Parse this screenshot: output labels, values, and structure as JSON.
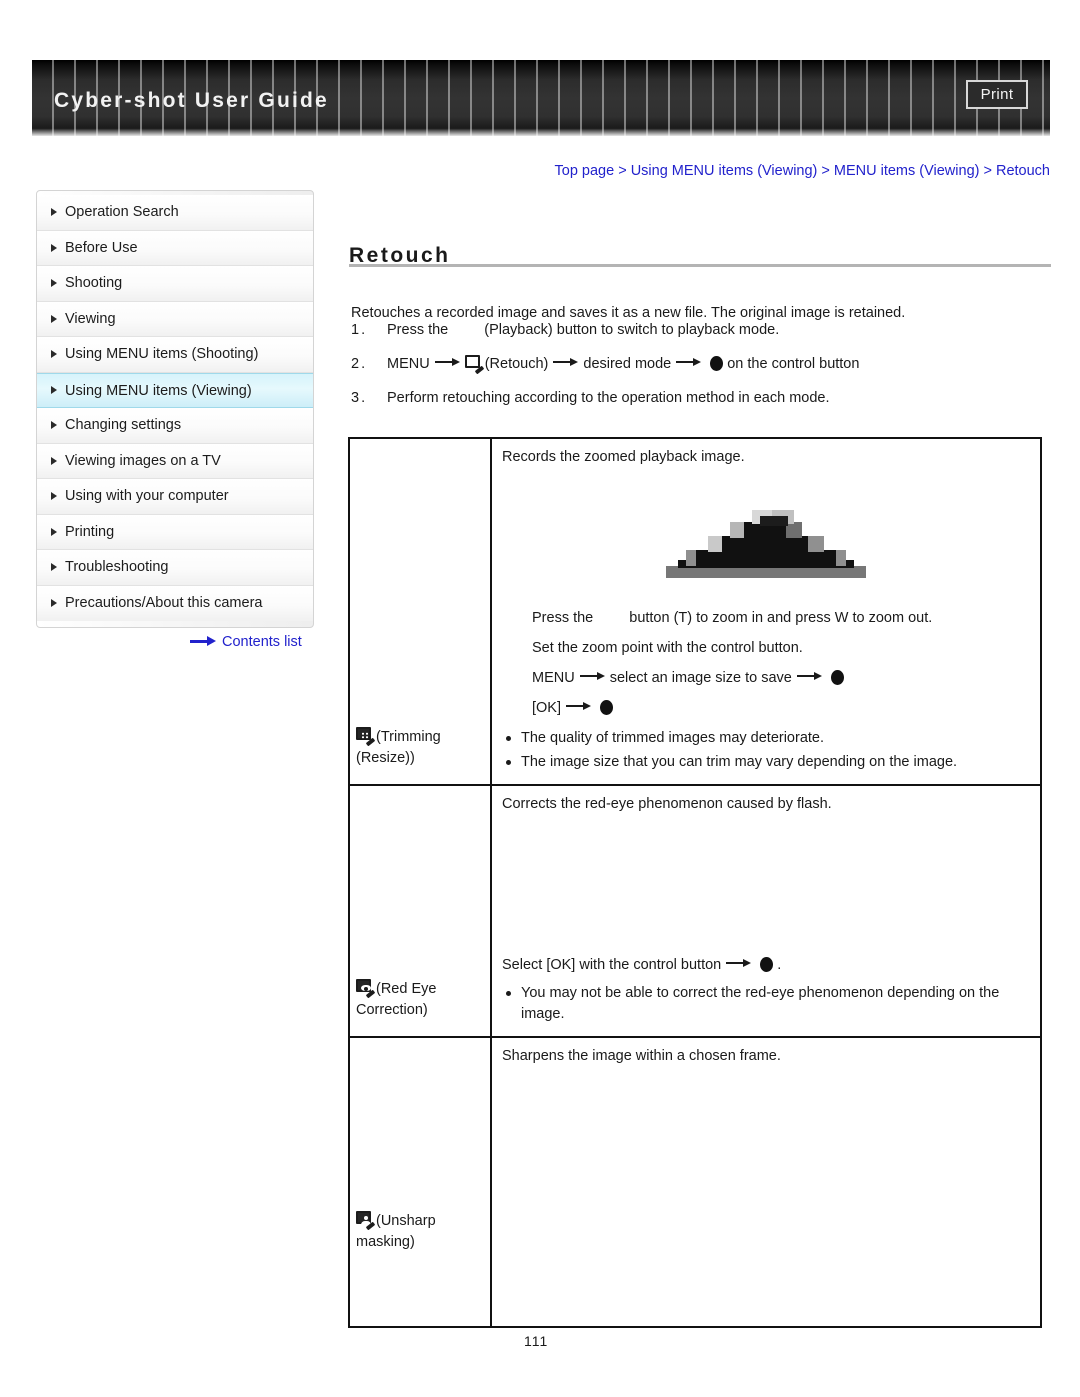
{
  "header": {
    "title": "Cyber-shot User Guide",
    "print_label": "Print"
  },
  "breadcrumb": {
    "text": "Top page > Using MENU items (Viewing) > MENU items (Viewing) > Retouch"
  },
  "sidebar": {
    "items": [
      {
        "label": "Operation Search",
        "active": false
      },
      {
        "label": "Before Use",
        "active": false
      },
      {
        "label": "Shooting",
        "active": false
      },
      {
        "label": "Viewing",
        "active": false
      },
      {
        "label": "Using MENU items (Shooting)",
        "active": false
      },
      {
        "label": "Using MENU items (Viewing)",
        "active": true
      },
      {
        "label": "Changing settings",
        "active": false
      },
      {
        "label": "Viewing images on a TV",
        "active": false
      },
      {
        "label": "Using with your computer",
        "active": false
      },
      {
        "label": "Printing",
        "active": false
      },
      {
        "label": "Troubleshooting",
        "active": false
      },
      {
        "label": "Precautions/About this camera",
        "active": false
      }
    ],
    "contents_link": "Contents list"
  },
  "main": {
    "title": "Retouch",
    "intro": "Retouches a recorded image and saves it as a new file. The original image is retained.",
    "steps": [
      {
        "num": "1.",
        "pre": "Press the",
        "post": "(Playback) button to switch to playback mode."
      },
      {
        "num": "2.",
        "pre": "MENU",
        "mid1": "(Retouch)",
        "mid2": "desired mode",
        "post": "on the control button"
      },
      {
        "num": "3.",
        "pre": "Perform retouching according to the operation method in each mode.",
        "post": ""
      }
    ],
    "table": {
      "rows": [
        {
          "name": "(Trimming (Resize))",
          "name_line1": "(Trimming",
          "name_line2": "(Resize))",
          "icon": "trimming-icon",
          "heading": "Records the zoomed playback image.",
          "sub_lines": [
            "Press the          button (T) to zoom in and press W to zoom out.",
            "Set the zoom point with the control button.",
            "MENU  →  select an image size to save  →  ●",
            "[OK]  →  ●"
          ],
          "notes": [
            "The quality of trimmed images may deteriorate.",
            "The image size that you can trim may vary depending on the image."
          ]
        },
        {
          "name": "(Red Eye Correction)",
          "name_line1": "(Red Eye",
          "name_line2": "Correction)",
          "icon": "red-eye-icon",
          "heading": "Corrects the red-eye phenomenon caused by flash.",
          "sub_lines": [
            "Select [OK] with the control button  →  ● ."
          ],
          "notes": [
            "You may not be able to correct the red-eye phenomenon depending on the image."
          ]
        },
        {
          "name": "(Unsharp masking)",
          "name_line1": "(Unsharp",
          "name_line2": "masking)",
          "icon": "unsharp-mask-icon",
          "heading": "Sharpens the image within a chosen frame.",
          "sub_lines": [],
          "notes": []
        }
      ]
    },
    "page_number": "111"
  },
  "chart_data": null
}
